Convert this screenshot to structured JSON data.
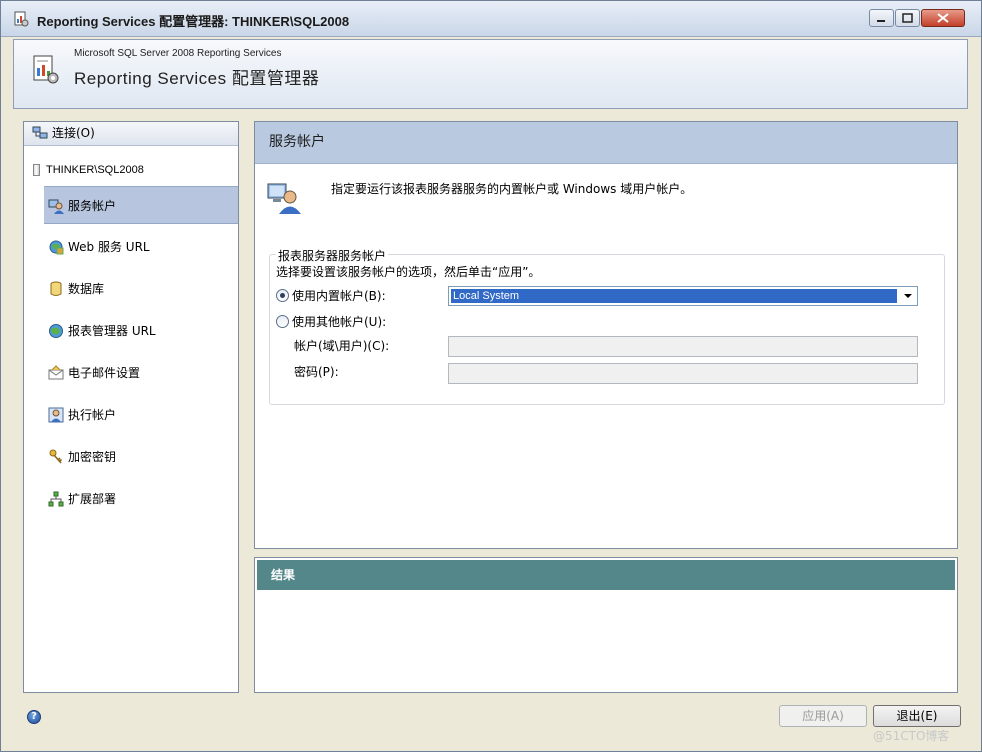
{
  "window": {
    "title": "Reporting Services 配置管理器: THINKER\\SQL2008",
    "minimize": "0",
    "maximize": "1",
    "close": "r"
  },
  "banner": {
    "subtitle": "Microsoft SQL Server 2008 Reporting Services",
    "title": "Reporting  Services  配置管理器"
  },
  "nav": {
    "connect_label": "连接(O)",
    "server": "THINKER\\SQL2008",
    "items": [
      {
        "label": "服务帐户",
        "icon": "service-account-icon",
        "selected": true
      },
      {
        "label": "Web 服务 URL",
        "icon": "web-service-icon"
      },
      {
        "label": "数据库",
        "icon": "database-icon"
      },
      {
        "label": "报表管理器 URL",
        "icon": "globe-icon"
      },
      {
        "label": "电子邮件设置",
        "icon": "email-icon"
      },
      {
        "label": "执行帐户",
        "icon": "execution-account-icon"
      },
      {
        "label": "加密密钥",
        "icon": "keys-icon"
      },
      {
        "label": "扩展部署",
        "icon": "scale-out-icon"
      }
    ]
  },
  "content": {
    "header": "服务帐户",
    "description": "指定要运行该报表服务器服务的内置帐户或 Windows 域用户帐户。",
    "group_title": "报表服务器服务帐户",
    "group_hint": "选择要设置该服务帐户的选项，然后单击“应用”。",
    "option_builtin": "使用内置帐户(B):",
    "builtin_value": "Local System",
    "option_other": "使用其他帐户(U):",
    "account_label": "帐户(域\\用户)(C):",
    "account_value": "",
    "password_label": "密码(P):",
    "password_value": ""
  },
  "results": {
    "header": "结果"
  },
  "footer": {
    "apply": "应用(A)",
    "exit": "退出(E)",
    "watermark": "@51CTO博客"
  }
}
